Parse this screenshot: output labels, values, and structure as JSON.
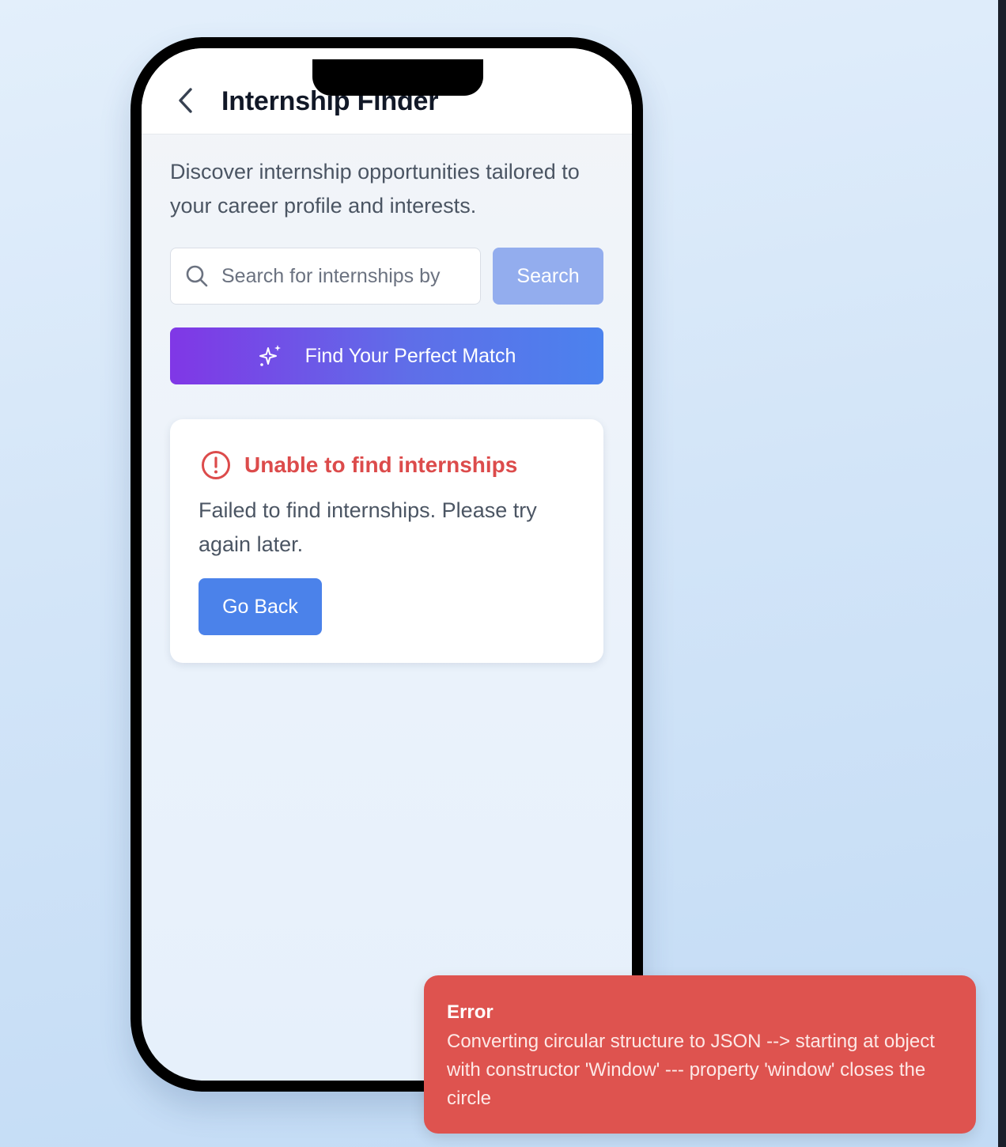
{
  "header": {
    "title": "Internship Finder",
    "back_icon": "chevron-left-icon"
  },
  "intro": {
    "text": "Discover internship opportunities tailored to your career profile and interests."
  },
  "search": {
    "placeholder": "Search for internships by",
    "value": "",
    "button_label": "Search",
    "icon": "search-icon"
  },
  "match": {
    "label": "Find Your Perfect Match",
    "icon": "sparkles-icon"
  },
  "error_card": {
    "icon": "alert-circle-icon",
    "title": "Unable to find internships",
    "message": "Failed to find internships. Please try again later.",
    "button_label": "Go Back"
  },
  "toast": {
    "title": "Error",
    "message": "Converting circular structure to JSON --> starting at object with constructor 'Window' --- property 'window' closes the circle"
  },
  "colors": {
    "primary": "#4b82ea",
    "search_button_disabled": "#93adee",
    "gradient_start": "#8037e6",
    "gradient_end": "#4b82ee",
    "error": "#dc4b4b",
    "toast_background": "#de534f"
  }
}
